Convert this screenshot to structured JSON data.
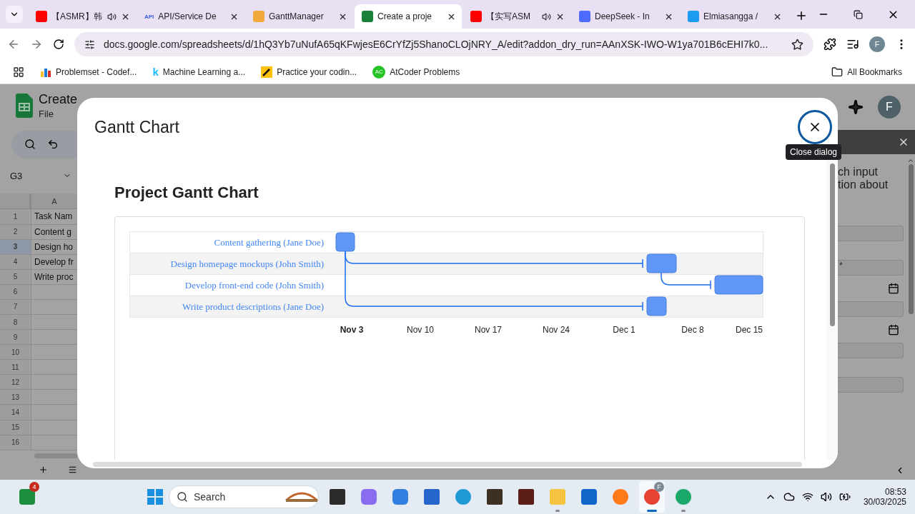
{
  "browser": {
    "tabs": [
      {
        "kind": "video",
        "title": "【ASMR】韩",
        "audio": true,
        "selected": false
      },
      {
        "kind": "api",
        "title": "API/Service De",
        "badge": "API",
        "audio": false,
        "selected": false
      },
      {
        "kind": "gantt",
        "title": "GanttManager",
        "audio": false,
        "selected": false
      },
      {
        "kind": "sheets",
        "title": "Create a proje",
        "audio": false,
        "selected": true
      },
      {
        "kind": "video",
        "title": "【实写ASM",
        "audio": true,
        "selected": false
      },
      {
        "kind": "whale",
        "title": "DeepSeek - In",
        "audio": false,
        "selected": false
      },
      {
        "kind": "plane",
        "title": "Elmiasangga /",
        "audio": false,
        "selected": false
      }
    ],
    "url": "docs.google.com/spreadsheets/d/1hQ3Yb7uNufA65qKFwjesE6CrYfZj5ShanoCLOjNRY_A/edit?addon_dry_run=AAnXSK-IWO-W1ya701B6cEHI7k0...",
    "profile_initial": "F",
    "bookmarks": [
      {
        "kind": "bars",
        "title": "Problemset - Codef..."
      },
      {
        "kind": "letter",
        "mark": "k",
        "title": "Machine Learning a..."
      },
      {
        "kind": "pen",
        "title": "Practice your codin..."
      },
      {
        "kind": "circle",
        "mark": "AC",
        "title": "AtCoder Problems"
      }
    ],
    "all_bookmarks": "All Bookmarks"
  },
  "sheet": {
    "title": "Create",
    "menu": [
      "File"
    ],
    "name_box": "G3",
    "column": "A",
    "profile_initial": "F",
    "rows": [
      {
        "number": "1",
        "cell": "Task Nam",
        "selected": false
      },
      {
        "number": "2",
        "cell": "Content g",
        "selected": false
      },
      {
        "number": "3",
        "cell": "Design ho",
        "selected": true
      },
      {
        "number": "4",
        "cell": "Develop fr",
        "selected": false
      },
      {
        "number": "5",
        "cell": "Write proc",
        "selected": false
      },
      {
        "number": "6",
        "selected": false
      },
      {
        "number": "7",
        "selected": false
      },
      {
        "number": "8",
        "selected": false
      },
      {
        "number": "9",
        "selected": false
      },
      {
        "number": "10",
        "selected": false
      },
      {
        "number": "11",
        "selected": false
      },
      {
        "number": "12",
        "selected": false
      },
      {
        "number": "13",
        "selected": false
      },
      {
        "number": "14",
        "selected": false
      },
      {
        "number": "15",
        "selected": false
      },
      {
        "number": "16",
        "selected": false
      }
    ]
  },
  "sidebar": {
    "text": [
      "ch input",
      "tion about"
    ],
    "fields": [
      {
        "kind": "text"
      },
      {
        "kind": "text",
        "value": "*"
      },
      {
        "kind": "date"
      },
      {
        "kind": "date"
      },
      {
        "kind": "text"
      }
    ]
  },
  "dialog": {
    "title": "Gantt Chart",
    "close_tooltip": "Close dialog",
    "heading": "Project Gantt Chart",
    "gantt": {
      "tasks": [
        "Content gathering (Jane Doe)",
        "Design homepage mockups (John Smith)",
        "Develop front-end code (John Smith)",
        "Write product descriptions (Jane Doe)"
      ],
      "axis_labels": [
        {
          "label": "Nov 3",
          "emphasized": true
        },
        {
          "label": "Nov 10",
          "emphasized": false
        },
        {
          "label": "Nov 17",
          "emphasized": false
        },
        {
          "label": "Nov 24",
          "emphasized": false
        },
        {
          "label": "Dec 1",
          "emphasized": false
        },
        {
          "label": "Dec 8",
          "emphasized": false
        },
        {
          "label": "Dec 15",
          "emphasized": false
        }
      ]
    }
  },
  "taskbar": {
    "badge": "4",
    "search_placeholder": "Search",
    "time": "08:53",
    "date": "30/03/2025",
    "apps": [
      {
        "kind": "terminal",
        "running": false,
        "active": false
      },
      {
        "kind": "copilot",
        "running": false,
        "active": false
      },
      {
        "kind": "cube",
        "running": false,
        "active": false
      },
      {
        "kind": "store",
        "running": false,
        "active": false
      },
      {
        "kind": "edge",
        "running": false,
        "active": false
      },
      {
        "kind": "game",
        "running": false,
        "active": false
      },
      {
        "kind": "game2",
        "running": false,
        "active": false
      },
      {
        "kind": "folder",
        "running": true,
        "active": false
      },
      {
        "kind": "mail",
        "running": false,
        "active": false
      },
      {
        "kind": "firefox",
        "running": false,
        "active": false
      },
      {
        "kind": "chrome",
        "running": true,
        "active": true,
        "badge": "F"
      },
      {
        "kind": "remote",
        "running": true,
        "active": false
      }
    ]
  }
}
